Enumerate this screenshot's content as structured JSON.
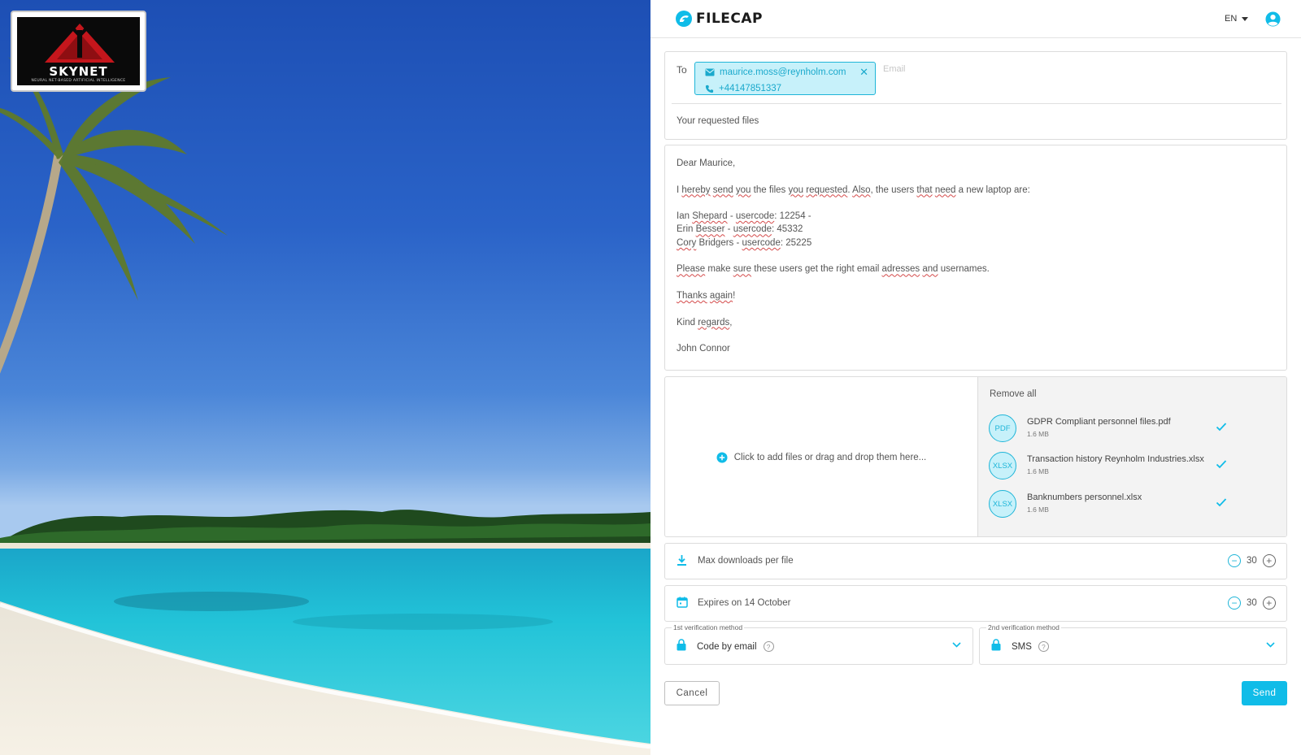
{
  "logo": {
    "name": "SKYNET",
    "tagline": "NEURAL NET-BASED ARTIFICIAL INTELLIGENCE"
  },
  "header": {
    "brand": "FILECAP",
    "language": "EN",
    "icons": {
      "brand": "filecap-logo-icon",
      "language": "caret-down-icon",
      "user": "user-circle-icon"
    }
  },
  "recipients": {
    "to_label": "To",
    "chip": {
      "email": "maurice.moss@reynholm.com",
      "phone": "+44147851337"
    },
    "email_placeholder": "Email",
    "subject": "Your requested files"
  },
  "message": {
    "greeting": "Dear Maurice,",
    "intro": {
      "a": "I ",
      "hereby": "hereby",
      "send": "send",
      "you1": "you",
      "b": " the files ",
      "you2": "you",
      "requested": "requested",
      "c": ". ",
      "also": "Also",
      "d": ", the users ",
      "that": "that",
      "need": "need",
      "e": " a new laptop are:"
    },
    "user1": {
      "first": "Ian ",
      "last": "Shepard",
      "dash": " - ",
      "code_label": "usercode",
      "code": ": 12254 -"
    },
    "user2": {
      "first": "Erin ",
      "last": "Besser",
      "dash": " - ",
      "code_label": "usercode",
      "code": ": 45332"
    },
    "user3": {
      "first": "Cory",
      "last": " Bridgers - ",
      "code_label": "usercode",
      "code": ": 25225"
    },
    "request": {
      "please": "Please",
      "a": " make ",
      "sure": "sure",
      "b": " these users get the right email ",
      "adresses": "adresses",
      "c": " ",
      "and": "and",
      "d": " usernames."
    },
    "thanks": {
      "thanks": "Thanks",
      "a": " ",
      "again": "again",
      "b": "!"
    },
    "closing": {
      "kind": "Kind ",
      "regards": "regards",
      "comma": ","
    },
    "signature": "John Connor"
  },
  "files": {
    "dropzone_text": "Click to add files or drag and drop them here...",
    "remove_all": "Remove all",
    "items": [
      {
        "type": "PDF",
        "name": "GDPR Compliant personnel files.pdf",
        "size": "1.6 MB"
      },
      {
        "type": "XLSX",
        "name": "Transaction history Reynholm Industries.xlsx",
        "size": "1.6 MB"
      },
      {
        "type": "XLSX",
        "name": "Banknumbers personnel.xlsx",
        "size": "1.6 MB"
      }
    ]
  },
  "settings": {
    "downloads": {
      "label": "Max downloads per file",
      "value": "30",
      "icon": "download-icon"
    },
    "expires": {
      "label": "Expires on 14 October",
      "value": "30",
      "icon": "calendar-icon"
    }
  },
  "verification": {
    "first": {
      "legend": "1st verification method",
      "value": "Code by email"
    },
    "second": {
      "legend": "2nd verification method",
      "value": "SMS"
    },
    "help": "?"
  },
  "actions": {
    "cancel": "Cancel",
    "send": "Send"
  },
  "colors": {
    "accent": "#10bce8",
    "chip_bg": "#c7f1fa",
    "chip_border": "#1fb5d8",
    "text": "#555555"
  }
}
